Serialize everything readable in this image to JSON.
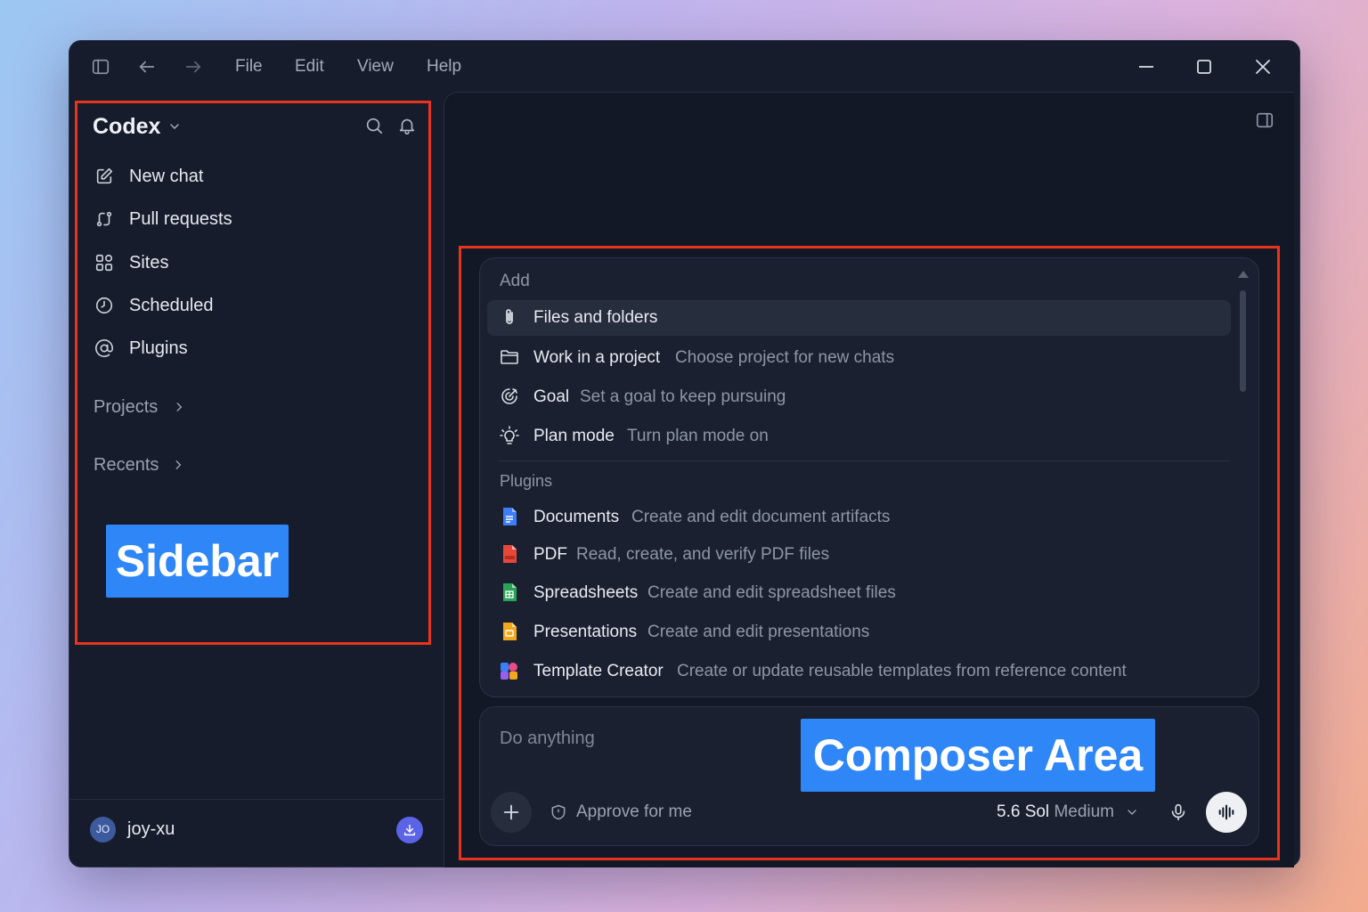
{
  "menubar": {
    "items": [
      "File",
      "Edit",
      "View",
      "Help"
    ]
  },
  "sidebar": {
    "brand": "Codex",
    "nav": [
      {
        "label": "New chat",
        "icon": "edit-icon"
      },
      {
        "label": "Pull requests",
        "icon": "git-pull-request-icon"
      },
      {
        "label": "Sites",
        "icon": "grid-icon"
      },
      {
        "label": "Scheduled",
        "icon": "clock-icon"
      },
      {
        "label": "Plugins",
        "icon": "at-sign-icon"
      }
    ],
    "sections": {
      "projects": "Projects",
      "recents": "Recents"
    },
    "user": {
      "initials": "JO",
      "name": "joy-xu"
    }
  },
  "annotations": {
    "sidebar_label": "Sidebar",
    "composer_label": "Composer Area"
  },
  "menu": {
    "add_header": "Add",
    "add_items": [
      {
        "title": "Files and folders",
        "desc": "",
        "icon": "paperclip-icon"
      },
      {
        "title": "Work in a project",
        "desc": "Choose project for new chats",
        "icon": "folder-icon"
      },
      {
        "title": "Goal",
        "desc": "Set a goal to keep pursuing",
        "icon": "target-icon"
      },
      {
        "title": "Plan mode",
        "desc": "Turn plan mode on",
        "icon": "lightbulb-icon"
      }
    ],
    "plugins_header": "Plugins",
    "plugin_items": [
      {
        "title": "Documents",
        "desc": "Create and edit document artifacts",
        "icon": "documents-icon"
      },
      {
        "title": "PDF",
        "desc": "Read, create, and verify PDF files",
        "icon": "pdf-icon"
      },
      {
        "title": "Spreadsheets",
        "desc": "Create and edit spreadsheet files",
        "icon": "spreadsheet-icon"
      },
      {
        "title": "Presentations",
        "desc": "Create and edit presentations",
        "icon": "presentation-icon"
      },
      {
        "title": "Template Creator",
        "desc": "Create or update reusable templates from reference content",
        "icon": "template-icon"
      }
    ]
  },
  "composer": {
    "placeholder": "Do anything",
    "approve": "Approve for me",
    "model": "5.6 Sol",
    "effort": "Medium"
  },
  "colors": {
    "accent_blue": "#2f86f6",
    "highlight_red": "#e8341c",
    "window_bg": "#161c2b"
  }
}
